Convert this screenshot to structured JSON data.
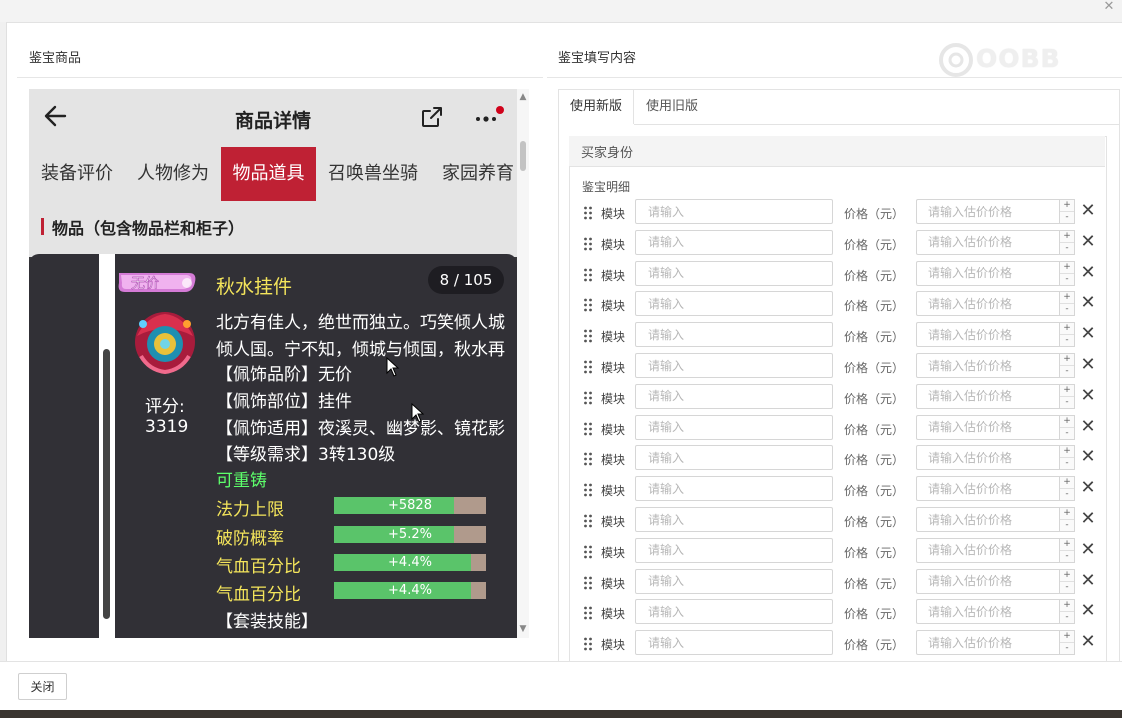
{
  "dialog": {
    "left_heading": "鉴宝商品",
    "right_heading": "鉴宝填写内容",
    "close_label": "关闭"
  },
  "watermark": {
    "text": "OOBB"
  },
  "phone": {
    "title": "商品详情",
    "tabs": [
      "装备评价",
      "人物修为",
      "物品道具",
      "召唤兽坐骑",
      "家园养育"
    ],
    "active_tab": "物品道具",
    "section_title": "物品（包含物品栏和柜子）",
    "item": {
      "badge": "无价",
      "name": "秋水挂件",
      "count": "8 / 105",
      "score_label": "评分:",
      "score_value": "3319",
      "desc_lines": [
        "北方有佳人，绝世而独立。巧笑倾人城",
        "倾人国。宁不知，倾城与倾国，秋水再",
        "【佩饰品阶】无价",
        "【佩饰部位】挂件",
        "【佩饰适用】夜溪灵、幽梦影、镜花影",
        "【等级需求】3转130级"
      ],
      "recast": "可重铸",
      "stats": [
        {
          "name": "法力上限",
          "value": "+5828",
          "fill": 0.79
        },
        {
          "name": "破防概率",
          "value": "+5.2%",
          "fill": 0.79
        },
        {
          "name": "气血百分比",
          "value": "+4.4%",
          "fill": 0.9
        },
        {
          "name": "气血百分比",
          "value": "+4.4%",
          "fill": 0.9
        }
      ],
      "suit_label": "【套装技能】"
    }
  },
  "form": {
    "tabs": [
      "使用新版",
      "使用旧版"
    ],
    "active_tab": "使用新版",
    "buyer_section": "买家身份",
    "detail_label": "鉴宝明细",
    "row_module_label": "模块",
    "row_module_placeholder": "请输入",
    "row_price_label": "价格（元）",
    "row_price_placeholder": "请输入估价价格",
    "stepper_up": "+",
    "stepper_down": "-",
    "delete_glyph": "✕",
    "row_count": 15
  },
  "colors": {
    "active_tab_red": "#bf2134",
    "item_name_yellow": "#f4e55b",
    "recast_green": "#5dff6b",
    "stat_fill_green": "#5ac46a",
    "card_dark": "#313036"
  },
  "icons": {
    "back": "arrow-left-icon",
    "share": "share-icon",
    "more": "more-icon",
    "grip": "drag-handle-icon",
    "delete": "close-icon"
  }
}
